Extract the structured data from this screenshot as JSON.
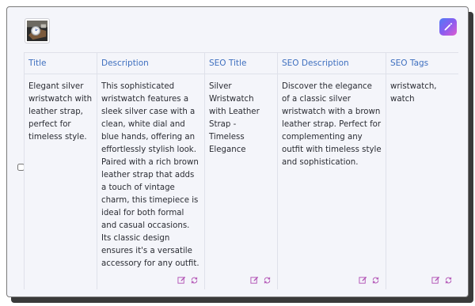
{
  "thumbnail": {
    "alt_icon": "wristwatch-photo-thumbnail"
  },
  "toolbar": {
    "edit_icon": "pencil-icon",
    "accent_gradient": [
      "#4f7cf5",
      "#8a5cf0",
      "#e05ccf"
    ]
  },
  "colors": {
    "header_text": "#3e6fbf",
    "action_icon": "#b04fb3"
  },
  "columns": [
    {
      "header": "Title",
      "value": "Elegant silver wristwatch with leather strap, perfect for timeless style."
    },
    {
      "header": "Description",
      "value": "This sophisticated wristwatch features a sleek silver case with a clean, white dial and blue hands, offering an effortlessly stylish look. Paired with a rich brown leather strap that adds a touch of vintage charm, this timepiece is ideal for both formal and casual occasions. Its classic design ensures it's a versatile accessory for any outfit."
    },
    {
      "header": "SEO Title",
      "value": "Silver Wristwatch with Leather Strap - Timeless Elegance"
    },
    {
      "header": "SEO Description",
      "value": "Discover the elegance of a classic silver wristwatch with a brown leather strap. Perfect for complementing any outfit with timeless style and sophistication."
    },
    {
      "header": "SEO Tags",
      "value": "wristwatch, watch"
    }
  ]
}
